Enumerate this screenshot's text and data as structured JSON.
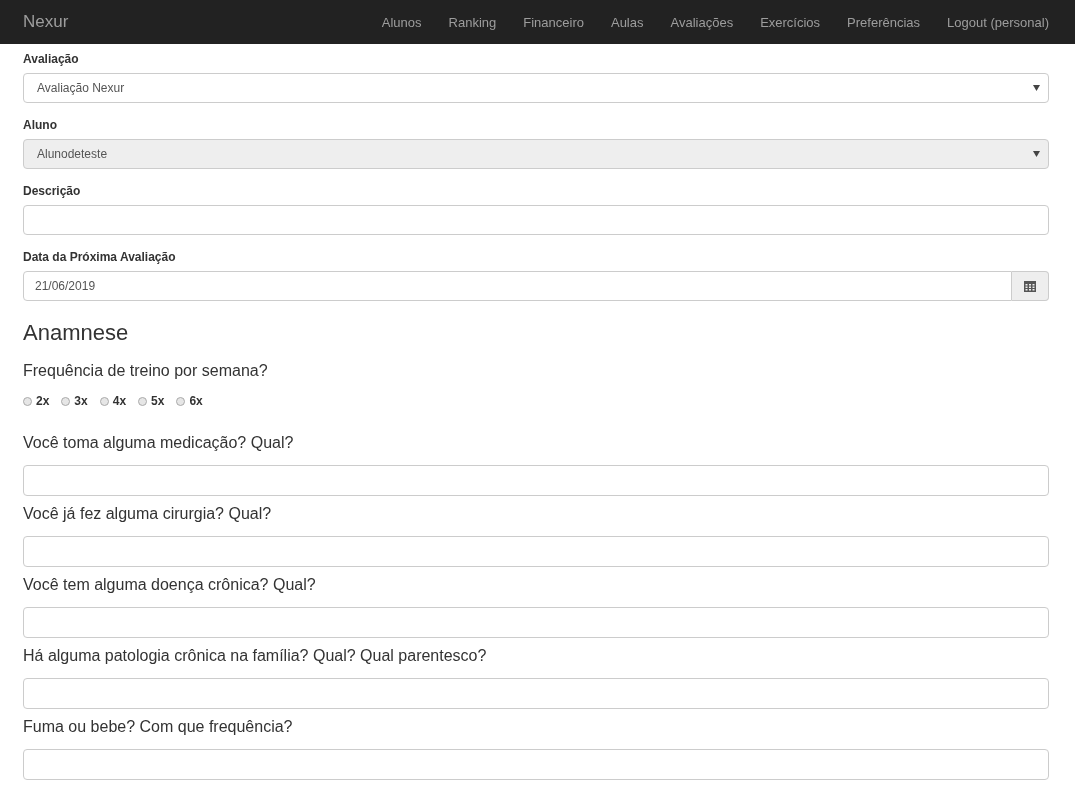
{
  "navbar": {
    "brand": "Nexur",
    "links": [
      "Alunos",
      "Ranking",
      "Financeiro",
      "Aulas",
      "Avaliações",
      "Exercícios",
      "Preferências",
      "Logout (personal)"
    ]
  },
  "fields": [
    {
      "label": "Avaliação",
      "kind": "select",
      "value": "Avaliação Nexur",
      "disabled": false
    },
    {
      "label": "Aluno",
      "kind": "select",
      "value": "Alunodeteste",
      "disabled": true
    },
    {
      "label": "Descrição",
      "kind": "text",
      "disabled": false
    },
    {
      "label": "Data da Próxima Avaliação",
      "kind": "date",
      "value": "21/06/2019",
      "disabled": false
    }
  ],
  "anamnese": {
    "heading": "Anamnese",
    "frequency": {
      "question": "Frequência de treino por semana?",
      "options": [
        {
          "label": "2x",
          "selected": false
        },
        {
          "label": "3x",
          "selected": false
        },
        {
          "label": "4x",
          "selected": false
        },
        {
          "label": "5x",
          "selected": false
        },
        {
          "label": "6x",
          "selected": false
        }
      ]
    },
    "questions": [
      "Você toma alguma medicação? Qual?",
      "Você já fez alguma cirurgia? Qual?",
      "Você tem alguma doença crônica? Qual?",
      "Há alguma patologia crônica na família? Qual? Qual parentesco?",
      "Fuma ou bebe? Com que frequência?"
    ]
  }
}
